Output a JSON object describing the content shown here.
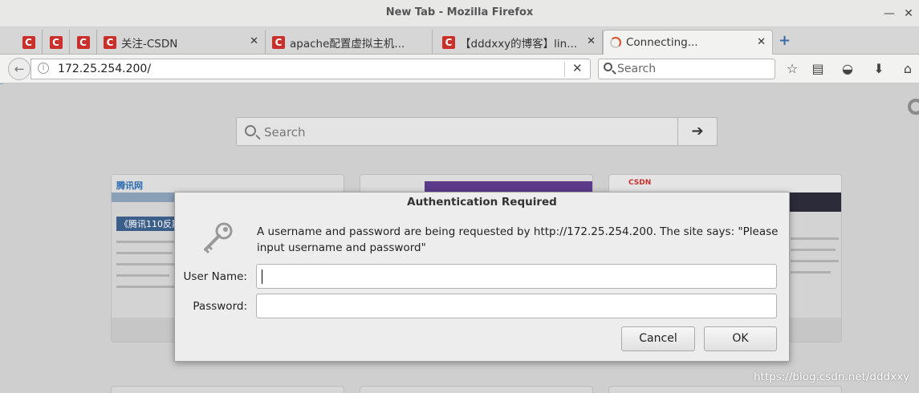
{
  "window": {
    "title": "New Tab - Mozilla Firefox"
  },
  "tabs": [
    {
      "label": "",
      "pinned": true
    },
    {
      "label": "",
      "pinned": true
    },
    {
      "label": "",
      "pinned": true
    },
    {
      "label": "关注-CSDN",
      "pinned": false
    },
    {
      "label": "apache配置虚拟主机...",
      "pinned": false
    },
    {
      "label": "【dddxxy的博客】lin...",
      "pinned": false
    },
    {
      "label": "Connecting...",
      "pinned": false,
      "active": true
    }
  ],
  "navbar": {
    "url": "172.25.254.200/",
    "search_placeholder": "Search"
  },
  "newtab": {
    "search_placeholder": "Search",
    "thumbnails": [
      {
        "site": "腾讯网",
        "headline": "《腾讯110反欺"
      },
      {
        "site": "",
        "headline": ""
      },
      {
        "site": "CSDN",
        "headline": ""
      }
    ]
  },
  "dialog": {
    "title": "Authentication Required",
    "message": "A username and password are being requested by http://172.25.254.200. The site says: \"Please input username and password\"",
    "username_label": "User Name:",
    "username_value": "",
    "password_label": "Password:",
    "password_value": "",
    "cancel_label": "Cancel",
    "ok_label": "OK"
  },
  "watermark": "https://blog.csdn.net/dddxxy",
  "colors": {
    "csdn_red": "#c9302c",
    "accent": "#3a6ea5"
  },
  "icons": [
    "back-icon",
    "info-icon",
    "clear-url-icon",
    "search-icon",
    "bookmark-star-icon",
    "reading-list-icon",
    "pocket-icon",
    "download-icon",
    "home-icon",
    "gear-icon",
    "arrow-right-icon",
    "key-icon",
    "new-tab-plus-icon"
  ]
}
